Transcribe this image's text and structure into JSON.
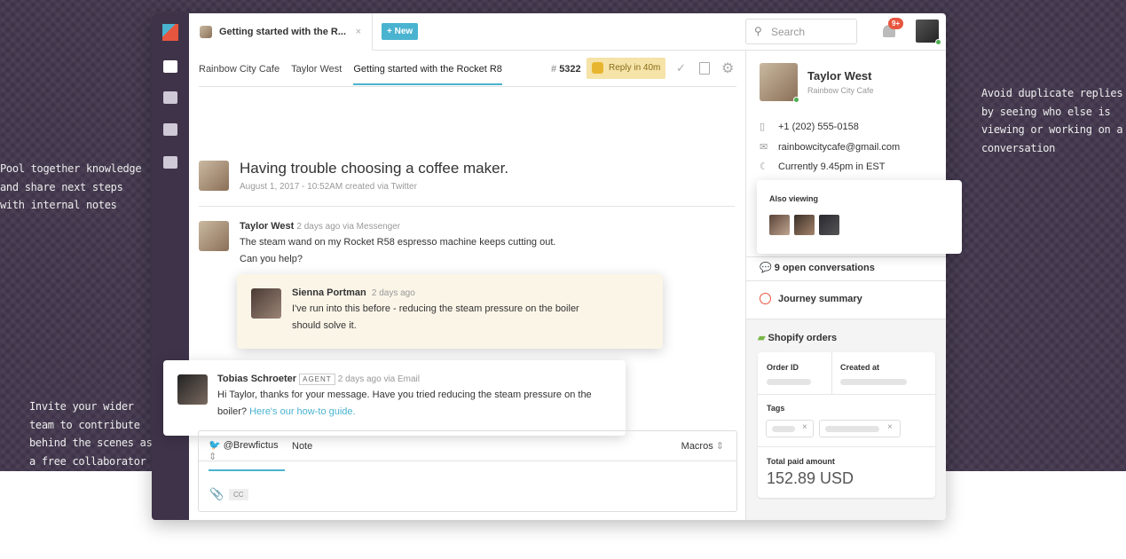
{
  "annotations": {
    "left_top": "Pool together knowledge and share next steps with internal notes",
    "left_bottom": "Invite your wider team to contribute behind the scenes as a free collaborator",
    "right": "Avoid duplicate replies by seeing who else is viewing or working on a conversation"
  },
  "tabbar": {
    "tab_title": "Getting started with the R...",
    "new_label": "+ New",
    "search_placeholder": "Search",
    "notifications_badge": "9+"
  },
  "breadcrumb": [
    "Rainbow City Cafe",
    "Taylor West",
    "Getting started with the Rocket R8"
  ],
  "conversation": {
    "hash": "#",
    "number": "5322",
    "reply_timer": "Reply in 40m",
    "title": "Having trouble choosing a coffee maker.",
    "meta": "August 1, 2017 - 10:52AM created via Twitter"
  },
  "messages": [
    {
      "author": "Taylor West",
      "meta": "2 days ago via Messenger",
      "lines": [
        "The steam wand on my Rocket R58 espresso machine keeps cutting out.",
        "Can you help?"
      ]
    },
    {
      "author": "Sienna Portman",
      "meta": "2 days ago",
      "lines": [
        "I've run into this before - reducing the steam pressure on the boiler",
        "should solve it."
      ]
    },
    {
      "author": "Tobias Schroeter",
      "badge": "AGENT",
      "meta": "2 days ago via Email",
      "text": "Hi Taylor, thanks for your message. Have you tried reducing the steam pressure on the",
      "text2": "boiler?",
      "link": "Here's our how-to guide."
    }
  ],
  "composer": {
    "account": "@Brewfictus",
    "note_tab": "Note",
    "macros": "Macros",
    "cc": "CC"
  },
  "contact": {
    "name": "Taylor West",
    "company": "Rainbow City Cafe",
    "phone": "+1 (202) 555-0158",
    "email": "rainbowcitycafe@gmail.com",
    "local_time": "Currently 9.45pm in EST"
  },
  "also_viewing": {
    "label": "Also viewing"
  },
  "open_conversations": "9 open conversations",
  "journey": "Journey summary",
  "shopify": {
    "title": "Shopify orders",
    "order_id": "Order ID",
    "created_at": "Created at",
    "tags": "Tags",
    "total_label": "Total paid amount",
    "total_value": "152.89 USD"
  },
  "colors": {
    "sidebar": "#3e3349",
    "accent": "#4ab3d0",
    "badge": "#e8553e",
    "timer": "#f5e3a8"
  }
}
